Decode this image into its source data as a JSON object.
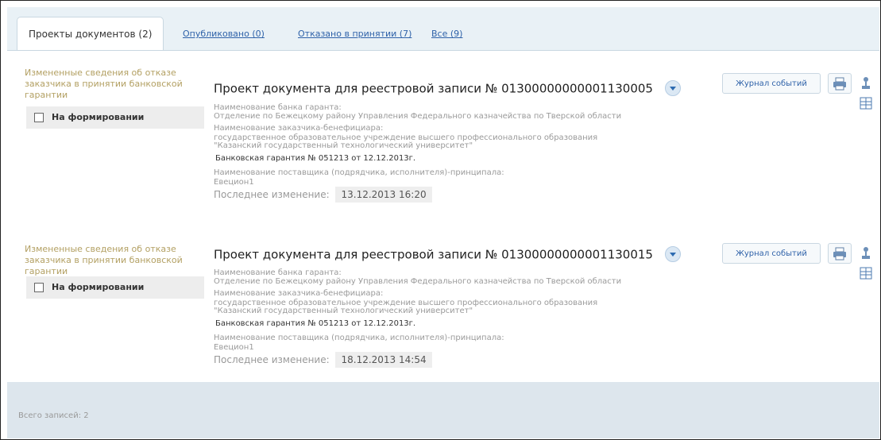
{
  "tabs": {
    "active": "Проекты документов (2)",
    "published": "Опубликовано (0)",
    "rejected": "Отказано в принятии (7)",
    "all": "Все (9)"
  },
  "records": [
    {
      "type_text": "Измененные сведения об отказе заказчика в принятии банковской гарантии",
      "status": "На формировании",
      "title": "Проект документа для реестровой записи  № 01300000000001130005",
      "bank_label": "Наименование банка гаранта:",
      "bank_value": "Отделение по Бежецкому району Управления Федерального казначейства по Тверской области",
      "beneficiary_label": "Наименование заказчика-бенефициара:",
      "beneficiary_value_1": "государственное образовательное учреждение высшего профессионального образования",
      "beneficiary_value_2": "\"Казанский государственный технологический университет\"",
      "guarantee": "Банковская гарантия № 051213 от 12.12.2013г.",
      "supplier_label": "Наименование поставщика (подрядчика, исполнителя)-принципала:",
      "supplier_value": "Евецион1",
      "modified_label": "Последнее изменение:",
      "modified_value": "13.12.2013 16:20",
      "journal_button": "Журнал событий"
    },
    {
      "type_text": "Измененные сведения об отказе заказчика в принятии банковской гарантии",
      "status": "На формировании",
      "title": "Проект документа для реестровой записи  № 01300000000001130015",
      "bank_label": "Наименование банка гаранта:",
      "bank_value": "Отделение по Бежецкому району Управления Федерального казначейства по Тверской области",
      "beneficiary_label": "Наименование заказчика-бенефициара:",
      "beneficiary_value_1": "государственное образовательное учреждение высшего профессионального образования",
      "beneficiary_value_2": "\"Казанский государственный технологический университет\"",
      "guarantee": "Банковская гарантия № 051213 от 12.12.2013г.",
      "supplier_label": "Наименование поставщика (подрядчика, исполнителя)-принципала:",
      "supplier_value": "Евецион1",
      "modified_label": "Последнее изменение:",
      "modified_value": "18.12.2013 14:54",
      "journal_button": "Журнал событий"
    }
  ],
  "footer": {
    "total": "Всего записей: 2"
  },
  "icons": {
    "print": "printer-icon",
    "tree": "tree-icon",
    "table": "table-icon",
    "status": "checkbox-icon",
    "expand": "chevron-down-icon"
  },
  "colors": {
    "link": "#2f62a9",
    "record_type": "#b3a063",
    "footer_bg": "#dde6ed",
    "tab_bg": "#e9f1f6"
  }
}
